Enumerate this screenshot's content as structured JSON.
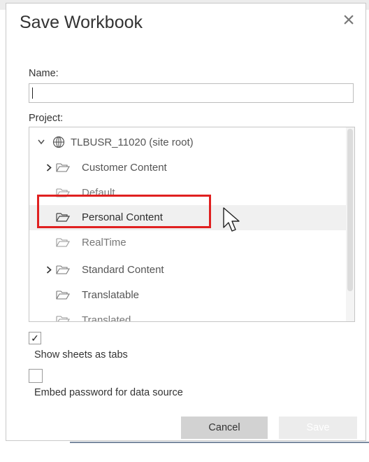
{
  "dialog": {
    "title": "Save Workbook",
    "close_glyph": "×"
  },
  "name_field": {
    "label": "Name:",
    "value": ""
  },
  "project": {
    "label": "Project:",
    "root": {
      "label": "TLBUSR_11020 (site root)",
      "icon": "globe-icon",
      "expanded": true
    },
    "items": [
      {
        "label": "Customer Content",
        "icon": "folder-icon",
        "expandable": true
      },
      {
        "label": "Default",
        "icon": "folder-icon",
        "expandable": false
      },
      {
        "label": "Personal Content",
        "icon": "folder-icon",
        "expandable": false,
        "selected": true
      },
      {
        "label": "RealTime",
        "icon": "folder-icon",
        "expandable": false
      },
      {
        "label": "Standard Content",
        "icon": "folder-icon",
        "expandable": true
      },
      {
        "label": "Translatable",
        "icon": "folder-icon",
        "expandable": false
      },
      {
        "label": "Translated",
        "icon": "folder-icon",
        "expandable": false
      }
    ]
  },
  "options": {
    "show_sheets_as_tabs": {
      "label": "Show sheets as tabs",
      "checked": true
    },
    "embed_password": {
      "label": "Embed password for data source",
      "checked": false
    }
  },
  "buttons": {
    "cancel": "Cancel",
    "save": "Save"
  },
  "colors": {
    "highlight": "#e02020",
    "selected_row": "#f0f0f0",
    "cancel_bg": "#d2d2d2",
    "save_bg": "#ececec"
  }
}
